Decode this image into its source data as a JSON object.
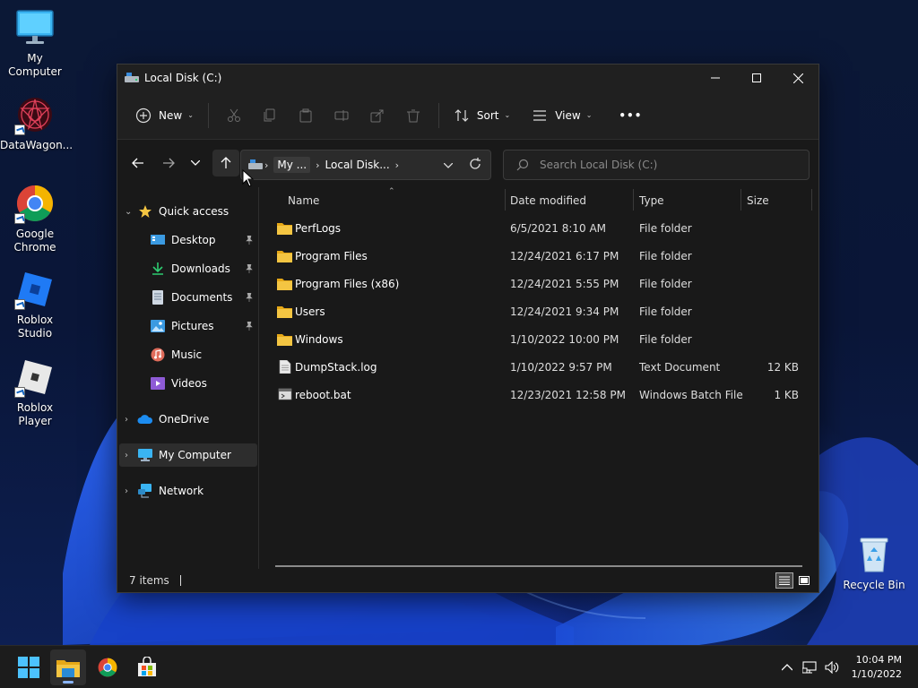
{
  "desktop": {
    "icons": [
      {
        "label": "My Computer"
      },
      {
        "label": "DataWagon..."
      },
      {
        "label": "Google Chrome"
      },
      {
        "label": "Roblox Studio"
      },
      {
        "label": "Roblox Player"
      },
      {
        "label": "Recycle Bin"
      }
    ]
  },
  "window": {
    "title": "Local Disk (C:)",
    "toolbar": {
      "new_label": "New",
      "sort_label": "Sort",
      "view_label": "View",
      "more_label": "•••"
    },
    "address": {
      "segments": [
        "My ...",
        "Local Disk..."
      ]
    },
    "search": {
      "placeholder": "Search Local Disk (C:)"
    },
    "sidebar": {
      "quick_access": "Quick access",
      "items": [
        {
          "label": "Desktop",
          "pinned": true
        },
        {
          "label": "Downloads",
          "pinned": true
        },
        {
          "label": "Documents",
          "pinned": true
        },
        {
          "label": "Pictures",
          "pinned": true
        },
        {
          "label": "Music",
          "pinned": false
        },
        {
          "label": "Videos",
          "pinned": false
        }
      ],
      "onedrive": "OneDrive",
      "my_computer": "My Computer",
      "network": "Network"
    },
    "columns": {
      "name": "Name",
      "date": "Date modified",
      "type": "Type",
      "size": "Size"
    },
    "files": [
      {
        "name": "PerfLogs",
        "date": "6/5/2021 8:10 AM",
        "type": "File folder",
        "size": "",
        "icon": "folder-icon"
      },
      {
        "name": "Program Files",
        "date": "12/24/2021 6:17 PM",
        "type": "File folder",
        "size": "",
        "icon": "folder-icon"
      },
      {
        "name": "Program Files (x86)",
        "date": "12/24/2021 5:55 PM",
        "type": "File folder",
        "size": "",
        "icon": "folder-icon"
      },
      {
        "name": "Users",
        "date": "12/24/2021 9:34 PM",
        "type": "File folder",
        "size": "",
        "icon": "folder-icon"
      },
      {
        "name": "Windows",
        "date": "1/10/2022 10:00 PM",
        "type": "File folder",
        "size": "",
        "icon": "folder-icon"
      },
      {
        "name": "DumpStack.log",
        "date": "1/10/2022 9:57 PM",
        "type": "Text Document",
        "size": "12 KB",
        "icon": "text-file-icon"
      },
      {
        "name": "reboot.bat",
        "date": "12/23/2021 12:58 PM",
        "type": "Windows Batch File",
        "size": "1 KB",
        "icon": "batch-file-icon"
      }
    ],
    "status": {
      "item_count": "7 items"
    }
  },
  "taskbar": {
    "clock_time": "10:04 PM",
    "clock_date": "1/10/2022"
  },
  "colors": {
    "accent": "#8ab4f8",
    "folder": "#f4c542",
    "window_bg": "#191919",
    "taskbar_bg": "#1c1c1c"
  }
}
